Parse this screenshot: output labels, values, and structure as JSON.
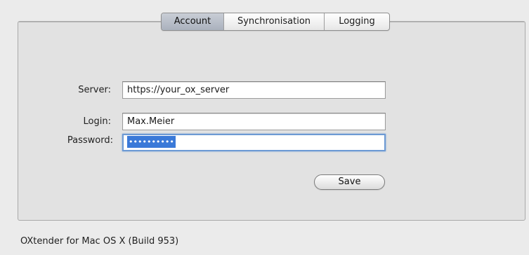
{
  "tabs": [
    {
      "label": "Account",
      "active": true
    },
    {
      "label": "Synchronisation",
      "active": false
    },
    {
      "label": "Logging",
      "active": false
    }
  ],
  "form": {
    "server_label": "Server:",
    "server_value": "https://your_ox_server",
    "login_label": "Login:",
    "login_value": "Max.Meier",
    "password_label": "Password:",
    "password_masked": "••••••••••",
    "save_label": "Save"
  },
  "footer": {
    "build_text": "OXtender for Mac OS X (Build 953)"
  },
  "colors": {
    "selection_highlight": "#3a79d8",
    "focus_ring": "#6d9ad4",
    "active_tab": "#b4bac5"
  }
}
